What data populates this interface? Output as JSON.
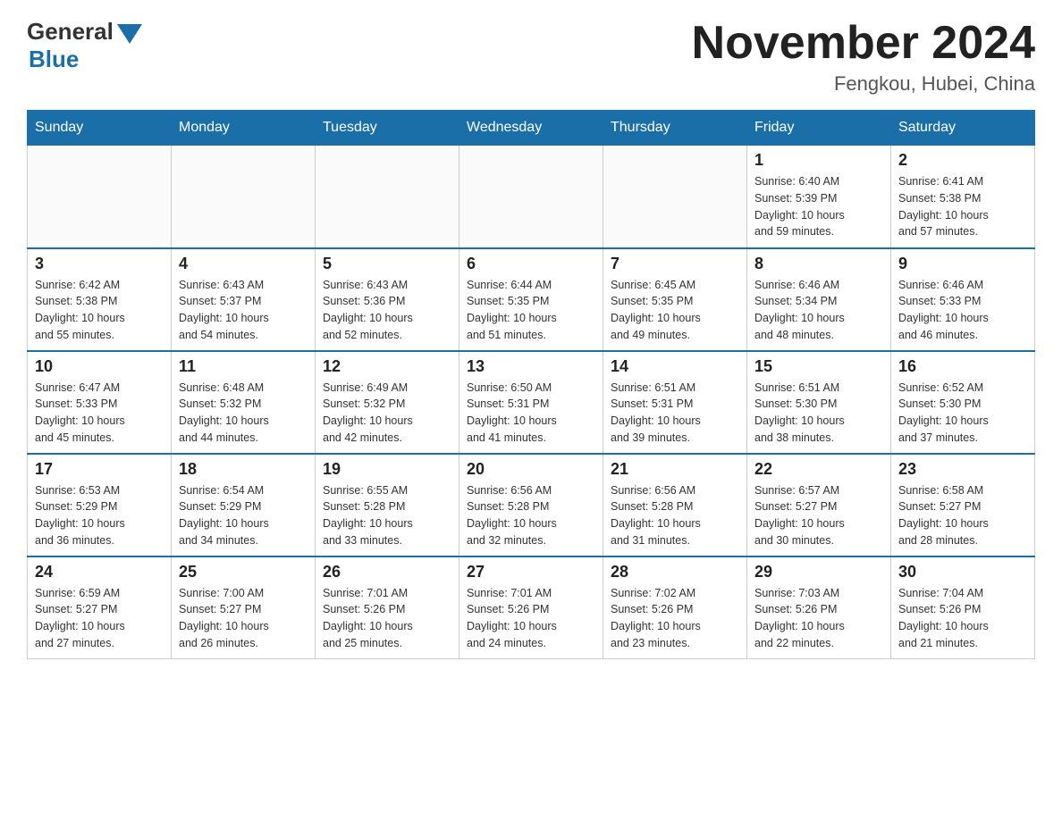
{
  "header": {
    "logo_general": "General",
    "logo_blue": "Blue",
    "month_title": "November 2024",
    "location": "Fengkou, Hubei, China"
  },
  "weekdays": [
    "Sunday",
    "Monday",
    "Tuesday",
    "Wednesday",
    "Thursday",
    "Friday",
    "Saturday"
  ],
  "weeks": [
    [
      {
        "day": "",
        "info": ""
      },
      {
        "day": "",
        "info": ""
      },
      {
        "day": "",
        "info": ""
      },
      {
        "day": "",
        "info": ""
      },
      {
        "day": "",
        "info": ""
      },
      {
        "day": "1",
        "info": "Sunrise: 6:40 AM\nSunset: 5:39 PM\nDaylight: 10 hours\nand 59 minutes."
      },
      {
        "day": "2",
        "info": "Sunrise: 6:41 AM\nSunset: 5:38 PM\nDaylight: 10 hours\nand 57 minutes."
      }
    ],
    [
      {
        "day": "3",
        "info": "Sunrise: 6:42 AM\nSunset: 5:38 PM\nDaylight: 10 hours\nand 55 minutes."
      },
      {
        "day": "4",
        "info": "Sunrise: 6:43 AM\nSunset: 5:37 PM\nDaylight: 10 hours\nand 54 minutes."
      },
      {
        "day": "5",
        "info": "Sunrise: 6:43 AM\nSunset: 5:36 PM\nDaylight: 10 hours\nand 52 minutes."
      },
      {
        "day": "6",
        "info": "Sunrise: 6:44 AM\nSunset: 5:35 PM\nDaylight: 10 hours\nand 51 minutes."
      },
      {
        "day": "7",
        "info": "Sunrise: 6:45 AM\nSunset: 5:35 PM\nDaylight: 10 hours\nand 49 minutes."
      },
      {
        "day": "8",
        "info": "Sunrise: 6:46 AM\nSunset: 5:34 PM\nDaylight: 10 hours\nand 48 minutes."
      },
      {
        "day": "9",
        "info": "Sunrise: 6:46 AM\nSunset: 5:33 PM\nDaylight: 10 hours\nand 46 minutes."
      }
    ],
    [
      {
        "day": "10",
        "info": "Sunrise: 6:47 AM\nSunset: 5:33 PM\nDaylight: 10 hours\nand 45 minutes."
      },
      {
        "day": "11",
        "info": "Sunrise: 6:48 AM\nSunset: 5:32 PM\nDaylight: 10 hours\nand 44 minutes."
      },
      {
        "day": "12",
        "info": "Sunrise: 6:49 AM\nSunset: 5:32 PM\nDaylight: 10 hours\nand 42 minutes."
      },
      {
        "day": "13",
        "info": "Sunrise: 6:50 AM\nSunset: 5:31 PM\nDaylight: 10 hours\nand 41 minutes."
      },
      {
        "day": "14",
        "info": "Sunrise: 6:51 AM\nSunset: 5:31 PM\nDaylight: 10 hours\nand 39 minutes."
      },
      {
        "day": "15",
        "info": "Sunrise: 6:51 AM\nSunset: 5:30 PM\nDaylight: 10 hours\nand 38 minutes."
      },
      {
        "day": "16",
        "info": "Sunrise: 6:52 AM\nSunset: 5:30 PM\nDaylight: 10 hours\nand 37 minutes."
      }
    ],
    [
      {
        "day": "17",
        "info": "Sunrise: 6:53 AM\nSunset: 5:29 PM\nDaylight: 10 hours\nand 36 minutes."
      },
      {
        "day": "18",
        "info": "Sunrise: 6:54 AM\nSunset: 5:29 PM\nDaylight: 10 hours\nand 34 minutes."
      },
      {
        "day": "19",
        "info": "Sunrise: 6:55 AM\nSunset: 5:28 PM\nDaylight: 10 hours\nand 33 minutes."
      },
      {
        "day": "20",
        "info": "Sunrise: 6:56 AM\nSunset: 5:28 PM\nDaylight: 10 hours\nand 32 minutes."
      },
      {
        "day": "21",
        "info": "Sunrise: 6:56 AM\nSunset: 5:28 PM\nDaylight: 10 hours\nand 31 minutes."
      },
      {
        "day": "22",
        "info": "Sunrise: 6:57 AM\nSunset: 5:27 PM\nDaylight: 10 hours\nand 30 minutes."
      },
      {
        "day": "23",
        "info": "Sunrise: 6:58 AM\nSunset: 5:27 PM\nDaylight: 10 hours\nand 28 minutes."
      }
    ],
    [
      {
        "day": "24",
        "info": "Sunrise: 6:59 AM\nSunset: 5:27 PM\nDaylight: 10 hours\nand 27 minutes."
      },
      {
        "day": "25",
        "info": "Sunrise: 7:00 AM\nSunset: 5:27 PM\nDaylight: 10 hours\nand 26 minutes."
      },
      {
        "day": "26",
        "info": "Sunrise: 7:01 AM\nSunset: 5:26 PM\nDaylight: 10 hours\nand 25 minutes."
      },
      {
        "day": "27",
        "info": "Sunrise: 7:01 AM\nSunset: 5:26 PM\nDaylight: 10 hours\nand 24 minutes."
      },
      {
        "day": "28",
        "info": "Sunrise: 7:02 AM\nSunset: 5:26 PM\nDaylight: 10 hours\nand 23 minutes."
      },
      {
        "day": "29",
        "info": "Sunrise: 7:03 AM\nSunset: 5:26 PM\nDaylight: 10 hours\nand 22 minutes."
      },
      {
        "day": "30",
        "info": "Sunrise: 7:04 AM\nSunset: 5:26 PM\nDaylight: 10 hours\nand 21 minutes."
      }
    ]
  ]
}
